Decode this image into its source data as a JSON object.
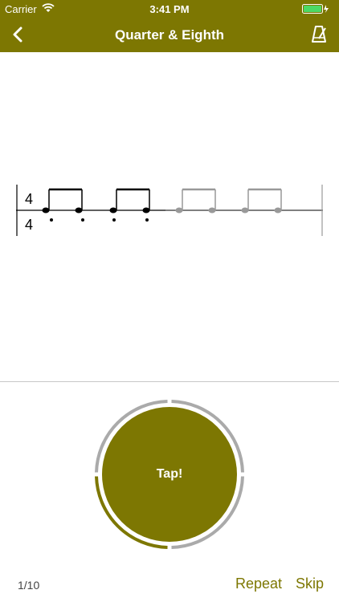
{
  "status": {
    "carrier": "Carrier",
    "time": "3:41 PM"
  },
  "nav": {
    "title": "Quarter & Eighth",
    "back_icon": "chevron-left-icon",
    "metronome_icon": "metronome-icon"
  },
  "score": {
    "time_signature_top": "4",
    "time_signature_bottom": "4",
    "active_color": "#000000",
    "inactive_color": "#999999"
  },
  "tap": {
    "label": "Tap!",
    "progress": 0.25,
    "button_color": "#7d7702",
    "ring_color": "#aaaaaa"
  },
  "footer": {
    "progress_text": "1/10",
    "repeat_label": "Repeat",
    "skip_label": "Skip"
  },
  "colors": {
    "accent": "#7d7702"
  }
}
